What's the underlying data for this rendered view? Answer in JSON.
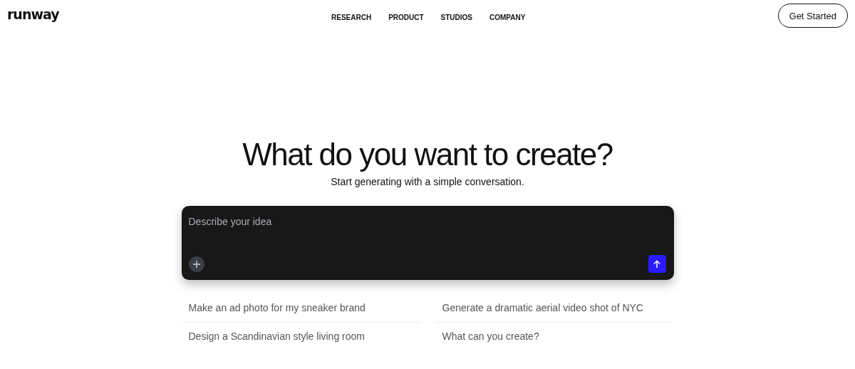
{
  "header": {
    "logo": "runway",
    "nav": [
      "RESEARCH",
      "PRODUCT",
      "STUDIOS",
      "COMPANY"
    ],
    "cta": "Get Started"
  },
  "hero": {
    "title": "What do you want to create?",
    "subtitle": "Start generating with a simple conversation."
  },
  "prompt": {
    "placeholder": "Describe your idea"
  },
  "suggestions": [
    "Make an ad photo for my sneaker brand",
    "Generate a dramatic aerial video shot of NYC",
    "Design a Scandinavian style living room",
    "What can you create?"
  ]
}
